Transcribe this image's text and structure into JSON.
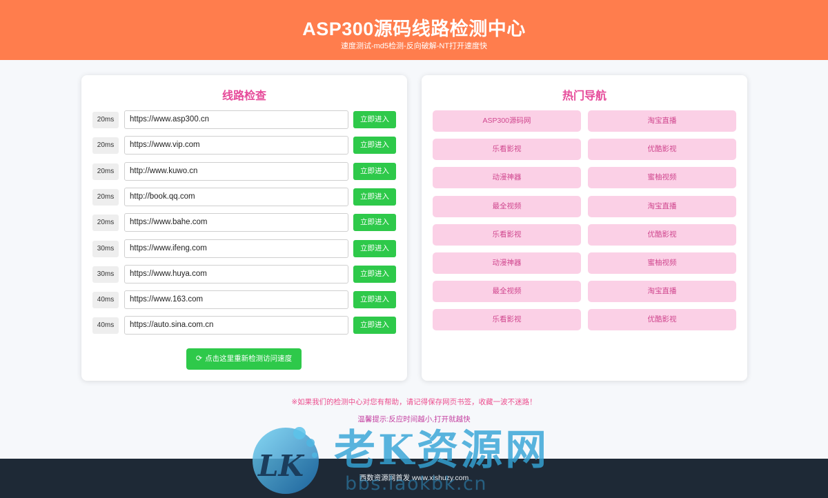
{
  "header": {
    "title": "ASP300源码线路检测中心",
    "subtitle": "速度测试-md5检测-反向破解-NT打开速度快"
  },
  "line_check": {
    "title": "线路检查",
    "button_label": "立即进入",
    "rows": [
      {
        "latency": "20ms",
        "url": "https://www.asp300.cn"
      },
      {
        "latency": "20ms",
        "url": "https://www.vip.com"
      },
      {
        "latency": "20ms",
        "url": "http://www.kuwo.cn"
      },
      {
        "latency": "20ms",
        "url": "http://book.qq.com"
      },
      {
        "latency": "20ms",
        "url": "https://www.bahe.com"
      },
      {
        "latency": "30ms",
        "url": "https://www.ifeng.com"
      },
      {
        "latency": "30ms",
        "url": "https://www.huya.com"
      },
      {
        "latency": "40ms",
        "url": "https://www.163.com"
      },
      {
        "latency": "40ms",
        "url": "https://auto.sina.com.cn"
      }
    ],
    "recheck_label": "点击这里重新检测访问速度",
    "recheck_icon": "refresh-icon"
  },
  "hot_nav": {
    "title": "热门导航",
    "items": [
      "ASP300源码网",
      "淘宝直播",
      "乐看影视",
      "优酷影视",
      "动漫神器",
      "蜜柚视频",
      "最全视频",
      "淘宝直播",
      "乐看影视",
      "优酷影视",
      "动漫神器",
      "蜜柚视频",
      "最全视频",
      "淘宝直播",
      "乐看影视",
      "优酷影视"
    ]
  },
  "tips": {
    "bookmark": "※如果我们的检测中心对您有帮助，请记得保存网页书签，收藏一波不迷路！",
    "hint": "温馨提示:反应时间越小,打开就越快"
  },
  "footer": {
    "text": "西数资源网首发 www.xishuzy.com"
  },
  "watermark": {
    "logo": "LK",
    "text": "老K资源网",
    "url": "bbs.laokbk.cn"
  },
  "colors": {
    "header_bg": "#ff7d4d",
    "accent_green": "#2ec94a",
    "nav_pink_bg": "#fbd0e6",
    "title_pink": "#e64b9a",
    "footer_bg": "#1e2936"
  }
}
